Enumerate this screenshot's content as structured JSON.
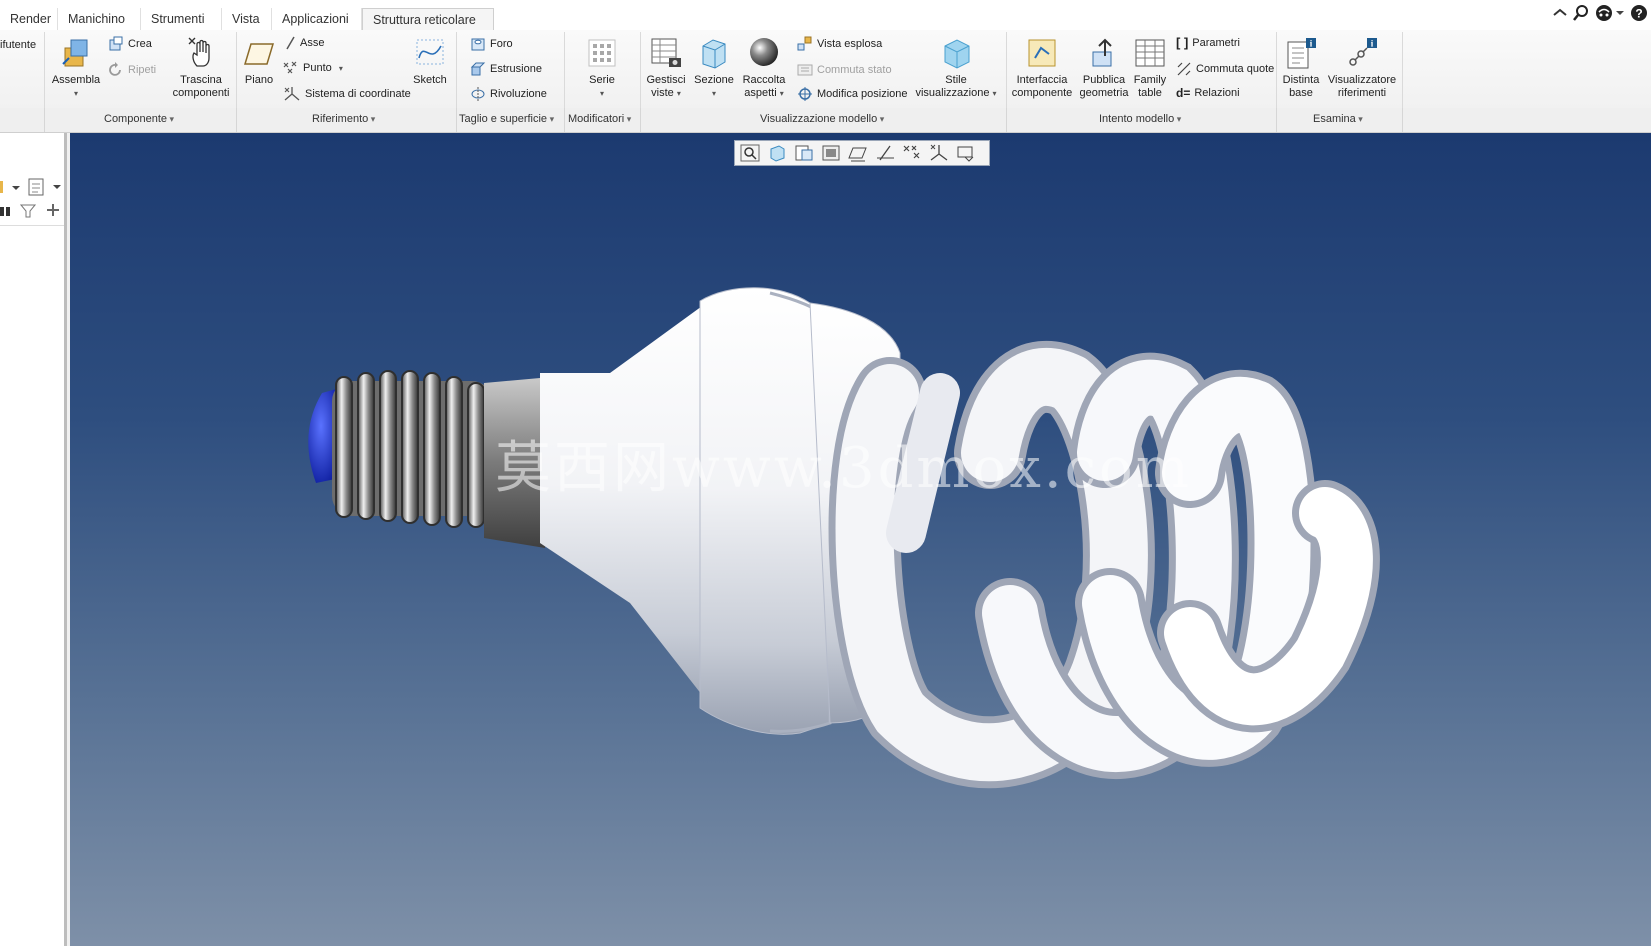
{
  "tabs": [
    "Render",
    "Manichino",
    "Strumenti",
    "Vista",
    "Applicazioni",
    "Struttura reticolare"
  ],
  "active_tab_index": 5,
  "ribbon": {
    "cut_label": "ifutente",
    "assembla": "Assembla",
    "crea": "Crea",
    "ripeti": "Ripeti",
    "trascina": [
      "Trascina",
      "componenti"
    ],
    "piano": "Piano",
    "asse": "Asse",
    "punto": "Punto",
    "sistema": "Sistema di coordinate",
    "sketch": "Sketch",
    "foro": "Foro",
    "estrusione": "Estrusione",
    "rivoluzione": "Rivoluzione",
    "serie": "Serie",
    "gestisci": [
      "Gestisci",
      "viste"
    ],
    "sezione": "Sezione",
    "raccolta": [
      "Raccolta",
      "aspetti"
    ],
    "vista_esplosa": "Vista esplosa",
    "commuta_stato": "Commuta stato",
    "modifica_posizione": "Modifica posizione",
    "stile": [
      "Stile",
      "visualizzazione"
    ],
    "interfaccia": [
      "Interfaccia",
      "componente"
    ],
    "pubblica": [
      "Pubblica",
      "geometria"
    ],
    "family": [
      "Family",
      "table"
    ],
    "parametri": "Parametri",
    "commuta_quote": "Commuta quote",
    "relazioni": "Relazioni",
    "distinta": [
      "Distinta",
      "base"
    ],
    "visualizzatore": [
      "Visualizzatore",
      "riferimenti"
    ]
  },
  "groups": [
    "Componente",
    "Riferimento",
    "Taglio e superficie",
    "Modificatori",
    "Visualizzazione modello",
    "Intento modello",
    "Esamina"
  ],
  "watermark": "莫西网www.3dmox.com",
  "icons": {
    "top_right": [
      "collapse-ribbon-icon",
      "search-icon",
      "community-icon",
      "help-icon"
    ],
    "view_toolbar": [
      "refit-icon",
      "saved-orientations-icon",
      "view-manager-icon",
      "display-style-icon",
      "datum-planes-icon",
      "datum-axes-icon",
      "datum-points-icon",
      "csys-icon",
      "annotations-icon"
    ]
  },
  "colors": {
    "viewport_top": "#1c3a70",
    "viewport_bottom": "#7e90a8",
    "accent_blue": "#1a5fb4",
    "base_tip": "#1b2fc9"
  }
}
